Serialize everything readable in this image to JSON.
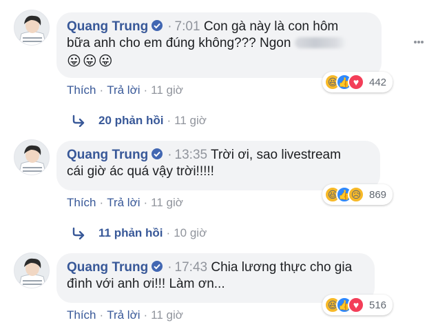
{
  "comments": [
    {
      "author": "Quang Trung",
      "time": "7:01",
      "text_line1": "Con gà này là con hôm",
      "text_line2": "bữa anh cho em đúng không??? Ngon",
      "emojis": [
        "😛",
        "😛",
        "😛"
      ],
      "reactions": [
        "haha-icon",
        "like-icon",
        "love-icon"
      ],
      "reaction_count": "442",
      "action_like": "Thích",
      "action_reply": "Trả lời",
      "age": "11 giờ"
    },
    {
      "author": "Quang Trung",
      "time": "13:35",
      "text_line1": "Trời ơi, sao livestream",
      "text_line2": "cái giờ ác quá vậy trời!!!!!",
      "reactions": [
        "haha-icon",
        "like-icon",
        "sad-icon"
      ],
      "reaction_count": "869",
      "action_like": "Thích",
      "action_reply": "Trả lời",
      "age": "11 giờ"
    },
    {
      "author": "Quang Trung",
      "time": "17:43",
      "text_line1": "Chia lương thực cho gia",
      "text_line2": "đình với anh ơi!!! Làm ơn...",
      "reactions": [
        "haha-icon",
        "like-icon",
        "love-icon"
      ],
      "reaction_count": "516",
      "action_like": "Thích",
      "action_reply": "Trả lời",
      "age": "11 giờ"
    }
  ],
  "reply_threads": [
    {
      "label": "20 phản hồi",
      "age": "11 giờ"
    },
    {
      "label": "11 phản hồi",
      "age": "10 giờ"
    }
  ],
  "separator": "·",
  "colors": {
    "name": "#385898",
    "bubble": "#f2f3f5",
    "muted": "#90949c",
    "verified": "#4267b2"
  }
}
